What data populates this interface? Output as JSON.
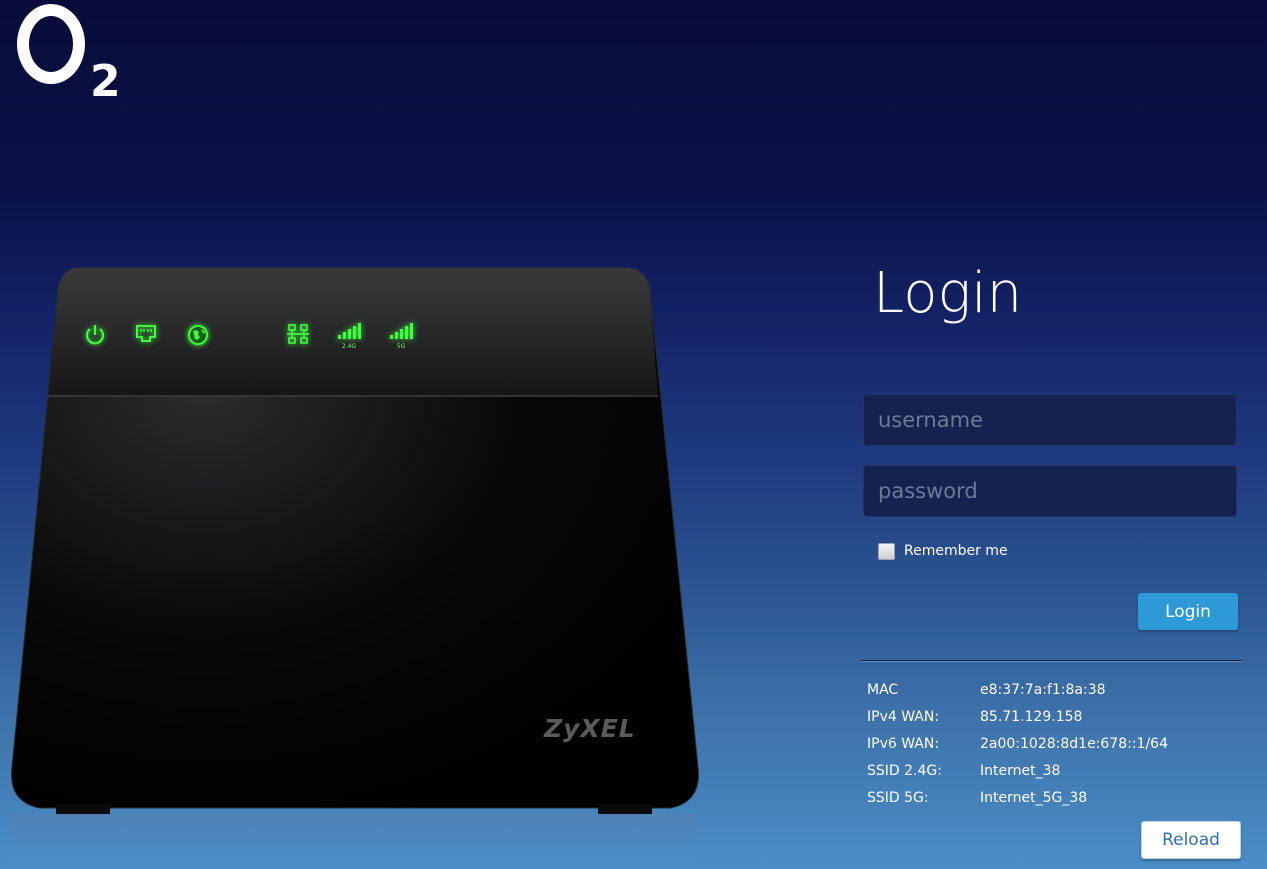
{
  "brand": {
    "logo_text": "O2",
    "logo_letter": "O",
    "logo_digit": "2"
  },
  "device": {
    "brand": "ZyXEL",
    "leds": [
      {
        "icon": "power-icon"
      },
      {
        "icon": "ethernet-icon"
      },
      {
        "icon": "globe-icon"
      },
      {
        "icon": "lan-icon"
      },
      {
        "icon": "wifi-signal-icon",
        "label": "2.4G"
      },
      {
        "icon": "wifi-signal-icon",
        "label": "5G"
      }
    ],
    "led_color": "#3cff3c"
  },
  "login": {
    "title": "Login",
    "username_placeholder": "username",
    "password_placeholder": "password",
    "remember_label": "Remember me",
    "submit_label": "Login"
  },
  "info": [
    {
      "label": "MAC",
      "value": "e8:37:7a:f1:8a:38"
    },
    {
      "label": "IPv4 WAN:",
      "value": "85.71.129.158"
    },
    {
      "label": "IPv6 WAN:",
      "value": "2a00:1028:8d1e:678::1/64"
    },
    {
      "label": "SSID 2.4G:",
      "value": "Internet_38"
    },
    {
      "label": "SSID 5G:",
      "value": "Internet_5G_38"
    }
  ],
  "reload_label": "Reload",
  "colors": {
    "accent": "#2d99d6",
    "background_top": "#070c3a",
    "background_bottom": "#4a8dc6"
  }
}
